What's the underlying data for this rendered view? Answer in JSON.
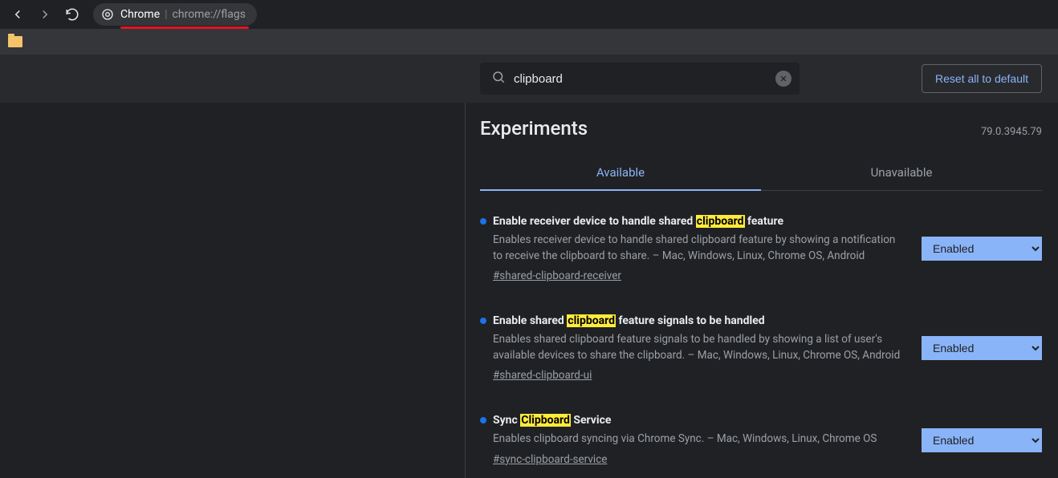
{
  "toolbar": {
    "omnibox_label": "Chrome",
    "omnibox_url": "chrome://flags"
  },
  "header": {
    "search_value": "clipboard",
    "reset_label": "Reset all to default"
  },
  "page": {
    "title": "Experiments",
    "version": "79.0.3945.79"
  },
  "tabs": {
    "available": "Available",
    "unavailable": "Unavailable"
  },
  "select_value": "Enabled",
  "flags": [
    {
      "title_pre": "Enable receiver device to handle shared ",
      "title_hl": "clipboard",
      "title_post": " feature",
      "desc": "Enables receiver device to handle shared clipboard feature by showing a notification to receive the clipboard to share. – Mac, Windows, Linux, Chrome OS, Android",
      "hash": "#shared-clipboard-receiver"
    },
    {
      "title_pre": "Enable shared ",
      "title_hl": "clipboard",
      "title_post": " feature signals to be handled",
      "desc": "Enables shared clipboard feature signals to be handled by showing a list of user's available devices to share the clipboard. – Mac, Windows, Linux, Chrome OS, Android",
      "hash": "#shared-clipboard-ui"
    },
    {
      "title_pre": "Sync ",
      "title_hl": "Clipboard",
      "title_post": " Service",
      "desc": "Enables clipboard syncing via Chrome Sync. – Mac, Windows, Linux, Chrome OS",
      "hash": "#sync-clipboard-service"
    }
  ]
}
